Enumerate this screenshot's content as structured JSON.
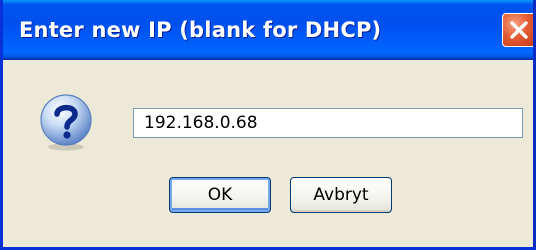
{
  "dialog": {
    "title": "Enter new IP (blank for DHCP)",
    "close_icon": "close-icon",
    "prompt_icon": "question-icon",
    "input_value": "192.168.0.68",
    "ok_label": "OK",
    "cancel_label": "Avbryt"
  },
  "colors": {
    "titlebar": "#0054e3",
    "dialog_background": "#ece9d8",
    "close_button": "#e55c33",
    "input_border": "#7f9db9"
  }
}
